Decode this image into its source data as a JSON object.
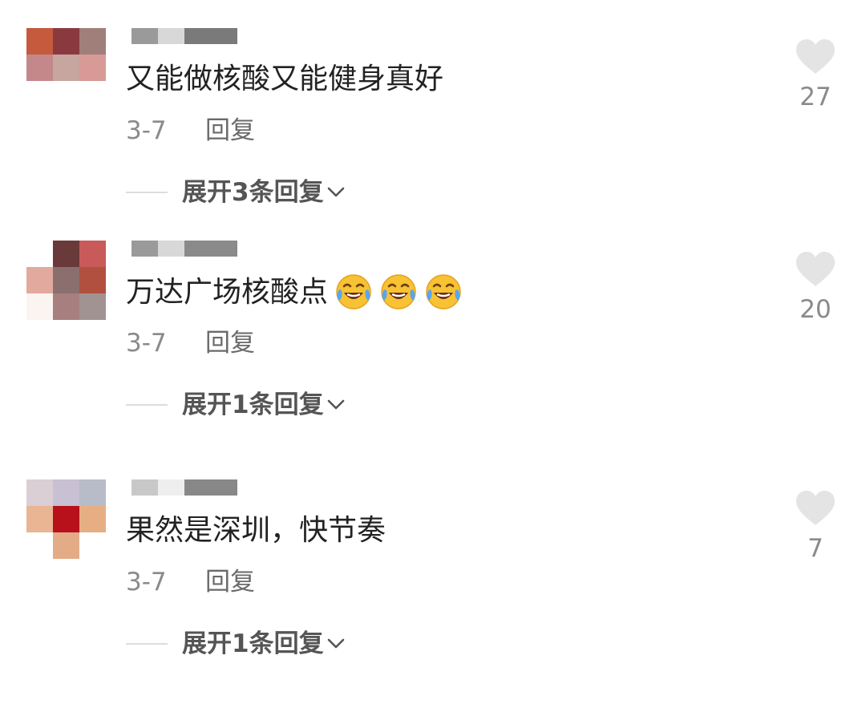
{
  "comments": [
    {
      "text": "又能做核酸又能健身真好",
      "emojis": [],
      "date": "3-7",
      "reply_label": "回复",
      "expand_label": "展开3条回复",
      "likes": "27",
      "avatar_colors": [
        "#c55a3c",
        "#8a3a3f",
        "#a07f7a",
        "#c4878a",
        "#c6a69f",
        "#d79a97",
        "#ffffff",
        "#ffffff",
        "#ffffff"
      ],
      "username_colors": [
        "#9a9a9a",
        "#d8d8d8",
        "#7a7a7a"
      ]
    },
    {
      "text": "万达广场核酸点",
      "emojis": [
        "rofl-emoji",
        "rofl-emoji",
        "rofl-emoji"
      ],
      "date": "3-7",
      "reply_label": "回复",
      "expand_label": "展开1条回复",
      "likes": "20",
      "avatar_colors": [
        "#ffffff",
        "#6a3a3a",
        "#c85a5a",
        "#e2a99e",
        "#8a6f6e",
        "#b25040",
        "#fbf4f0",
        "#a77f7f",
        "#a09392"
      ],
      "username_colors": [
        "#9a9a9a",
        "#d8d8d8",
        "#8a8a8a"
      ]
    },
    {
      "text": "果然是深圳，快节奏",
      "emojis": [],
      "date": "3-7",
      "reply_label": "回复",
      "expand_label": "展开1条回复",
      "likes": "7",
      "avatar_colors": [
        "#d9cfd5",
        "#c8c0d3",
        "#b8bcc8",
        "#e9b592",
        "#b8111c",
        "#e7ae83",
        "#ffffff",
        "#e3ac87",
        "#ffffff"
      ],
      "username_colors": [
        "#c8c8c8",
        "#eeeeee",
        "#888888"
      ]
    }
  ],
  "colors": {
    "text": "#222222",
    "meta": "#8a8a8a",
    "expand": "#555555",
    "heart": "#e4e4e4"
  }
}
